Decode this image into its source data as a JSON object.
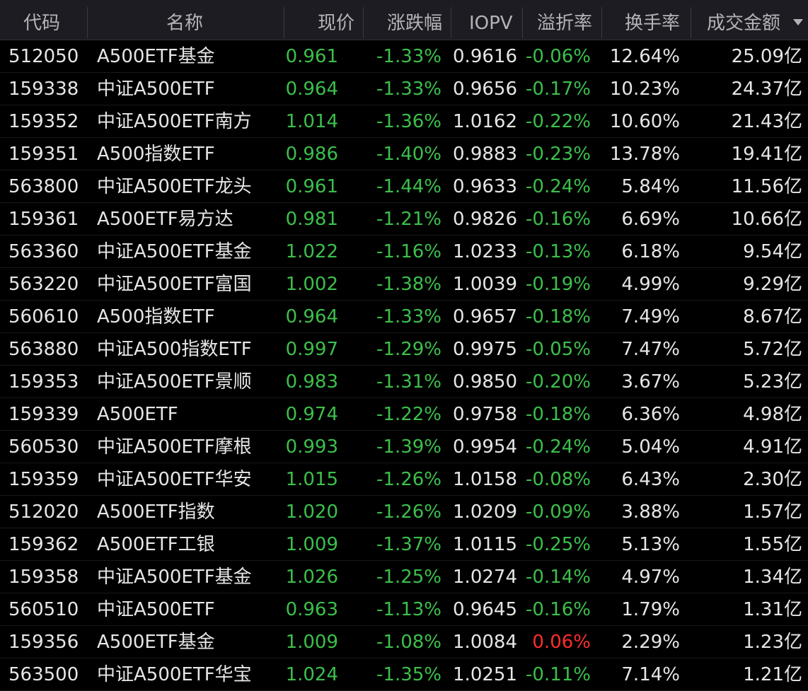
{
  "colors": {
    "down": "#3cbf4b",
    "up": "#ff2d2d",
    "neutral": "#e6e6e6",
    "header_bg": "#1c1c22",
    "header_text": "#b4b4b8",
    "background": "#000000"
  },
  "header": {
    "code": "代码",
    "name": "名称",
    "price": "现价",
    "change_pct": "涨跌幅",
    "iopv": "IOPV",
    "premium": "溢折率",
    "turnover": "换手率",
    "amount": "成交金额",
    "sort_icon": "caret-down-icon"
  },
  "rows": [
    {
      "code": "512050",
      "name": "A500ETF基金",
      "price": "0.961",
      "change_pct": "-1.33%",
      "iopv": "0.9616",
      "premium": "-0.06%",
      "turnover": "12.64%",
      "amount": "25.09亿"
    },
    {
      "code": "159338",
      "name": "中证A500ETF",
      "price": "0.964",
      "change_pct": "-1.33%",
      "iopv": "0.9656",
      "premium": "-0.17%",
      "turnover": "10.23%",
      "amount": "24.37亿"
    },
    {
      "code": "159352",
      "name": "中证A500ETF南方",
      "price": "1.014",
      "change_pct": "-1.36%",
      "iopv": "1.0162",
      "premium": "-0.22%",
      "turnover": "10.60%",
      "amount": "21.43亿"
    },
    {
      "code": "159351",
      "name": "A500指数ETF",
      "price": "0.986",
      "change_pct": "-1.40%",
      "iopv": "0.9883",
      "premium": "-0.23%",
      "turnover": "13.78%",
      "amount": "19.41亿"
    },
    {
      "code": "563800",
      "name": "中证A500ETF龙头",
      "price": "0.961",
      "change_pct": "-1.44%",
      "iopv": "0.9633",
      "premium": "-0.24%",
      "turnover": "5.84%",
      "amount": "11.56亿"
    },
    {
      "code": "159361",
      "name": "A500ETF易方达",
      "price": "0.981",
      "change_pct": "-1.21%",
      "iopv": "0.9826",
      "premium": "-0.16%",
      "turnover": "6.69%",
      "amount": "10.66亿"
    },
    {
      "code": "563360",
      "name": "中证A500ETF基金",
      "price": "1.022",
      "change_pct": "-1.16%",
      "iopv": "1.0233",
      "premium": "-0.13%",
      "turnover": "6.18%",
      "amount": "9.54亿"
    },
    {
      "code": "563220",
      "name": "中证A500ETF富国",
      "price": "1.002",
      "change_pct": "-1.38%",
      "iopv": "1.0039",
      "premium": "-0.19%",
      "turnover": "4.99%",
      "amount": "9.29亿"
    },
    {
      "code": "560610",
      "name": "A500指数ETF",
      "price": "0.964",
      "change_pct": "-1.33%",
      "iopv": "0.9657",
      "premium": "-0.18%",
      "turnover": "7.49%",
      "amount": "8.67亿"
    },
    {
      "code": "563880",
      "name": "中证A500指数ETF",
      "price": "0.997",
      "change_pct": "-1.29%",
      "iopv": "0.9975",
      "premium": "-0.05%",
      "turnover": "7.47%",
      "amount": "5.72亿"
    },
    {
      "code": "159353",
      "name": "中证A500ETF景顺",
      "price": "0.983",
      "change_pct": "-1.31%",
      "iopv": "0.9850",
      "premium": "-0.20%",
      "turnover": "3.67%",
      "amount": "5.23亿"
    },
    {
      "code": "159339",
      "name": "A500ETF",
      "price": "0.974",
      "change_pct": "-1.22%",
      "iopv": "0.9758",
      "premium": "-0.18%",
      "turnover": "6.36%",
      "amount": "4.98亿"
    },
    {
      "code": "560530",
      "name": "中证A500ETF摩根",
      "price": "0.993",
      "change_pct": "-1.39%",
      "iopv": "0.9954",
      "premium": "-0.24%",
      "turnover": "5.04%",
      "amount": "4.91亿"
    },
    {
      "code": "159359",
      "name": "中证A500ETF华安",
      "price": "1.015",
      "change_pct": "-1.26%",
      "iopv": "1.0158",
      "premium": "-0.08%",
      "turnover": "6.43%",
      "amount": "2.30亿"
    },
    {
      "code": "512020",
      "name": "A500ETF指数",
      "price": "1.020",
      "change_pct": "-1.26%",
      "iopv": "1.0209",
      "premium": "-0.09%",
      "turnover": "3.88%",
      "amount": "1.57亿"
    },
    {
      "code": "159362",
      "name": "A500ETF工银",
      "price": "1.009",
      "change_pct": "-1.37%",
      "iopv": "1.0115",
      "premium": "-0.25%",
      "turnover": "5.13%",
      "amount": "1.55亿"
    },
    {
      "code": "159358",
      "name": "中证A500ETF基金",
      "price": "1.026",
      "change_pct": "-1.25%",
      "iopv": "1.0274",
      "premium": "-0.14%",
      "turnover": "4.97%",
      "amount": "1.34亿"
    },
    {
      "code": "560510",
      "name": "中证A500ETF",
      "price": "0.963",
      "change_pct": "-1.13%",
      "iopv": "0.9645",
      "premium": "-0.16%",
      "turnover": "1.79%",
      "amount": "1.31亿"
    },
    {
      "code": "159356",
      "name": "A500ETF基金",
      "price": "1.009",
      "change_pct": "-1.08%",
      "iopv": "1.0084",
      "premium": "0.06%",
      "turnover": "2.29%",
      "amount": "1.23亿"
    },
    {
      "code": "563500",
      "name": "中证A500ETF华宝",
      "price": "1.024",
      "change_pct": "-1.35%",
      "iopv": "1.0251",
      "premium": "-0.11%",
      "turnover": "7.14%",
      "amount": "1.21亿"
    }
  ]
}
